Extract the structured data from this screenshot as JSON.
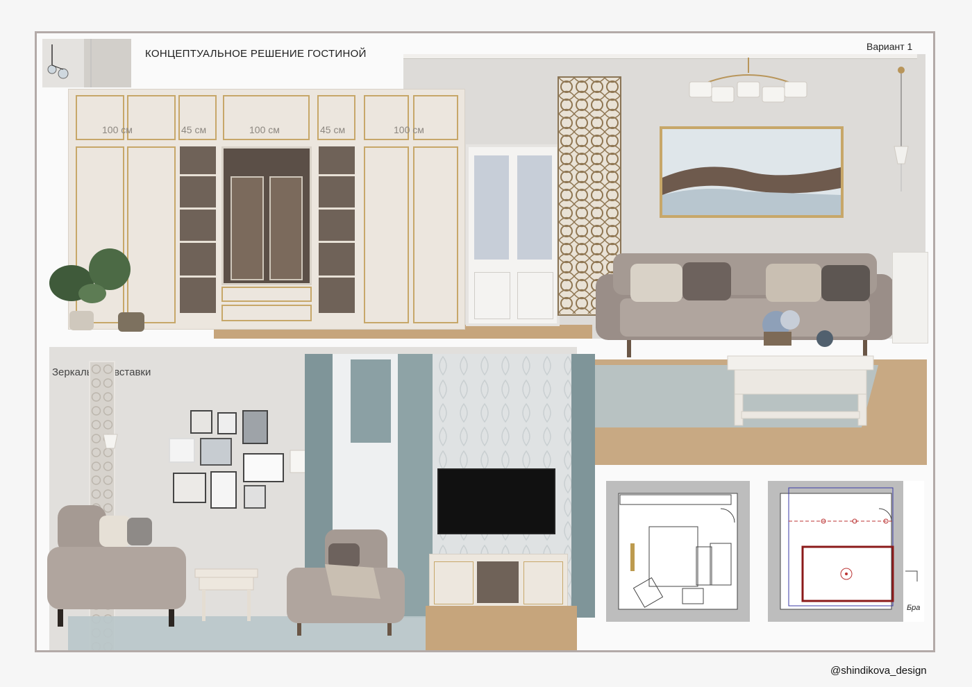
{
  "header": {
    "title": "КОНЦЕПТУАЛЬНОЕ РЕШЕНИЕ ГОСТИНОЙ",
    "variant": "Вариант 1"
  },
  "wardrobe": {
    "dims": [
      "100 см",
      "45 см",
      "100 см",
      "45 см",
      "100 см"
    ]
  },
  "lower_left": {
    "label": "Зеркальные вставки"
  },
  "plan2": {
    "note": "Бра"
  },
  "footer": {
    "credit": "@shindikova_design"
  },
  "icons": [
    "chandelier-icon",
    "pendant-lamp-icon",
    "floor-lamp-icon",
    "plant-icon",
    "sofa-icon",
    "armchair-icon",
    "coffee-table-icon",
    "tv-icon"
  ]
}
